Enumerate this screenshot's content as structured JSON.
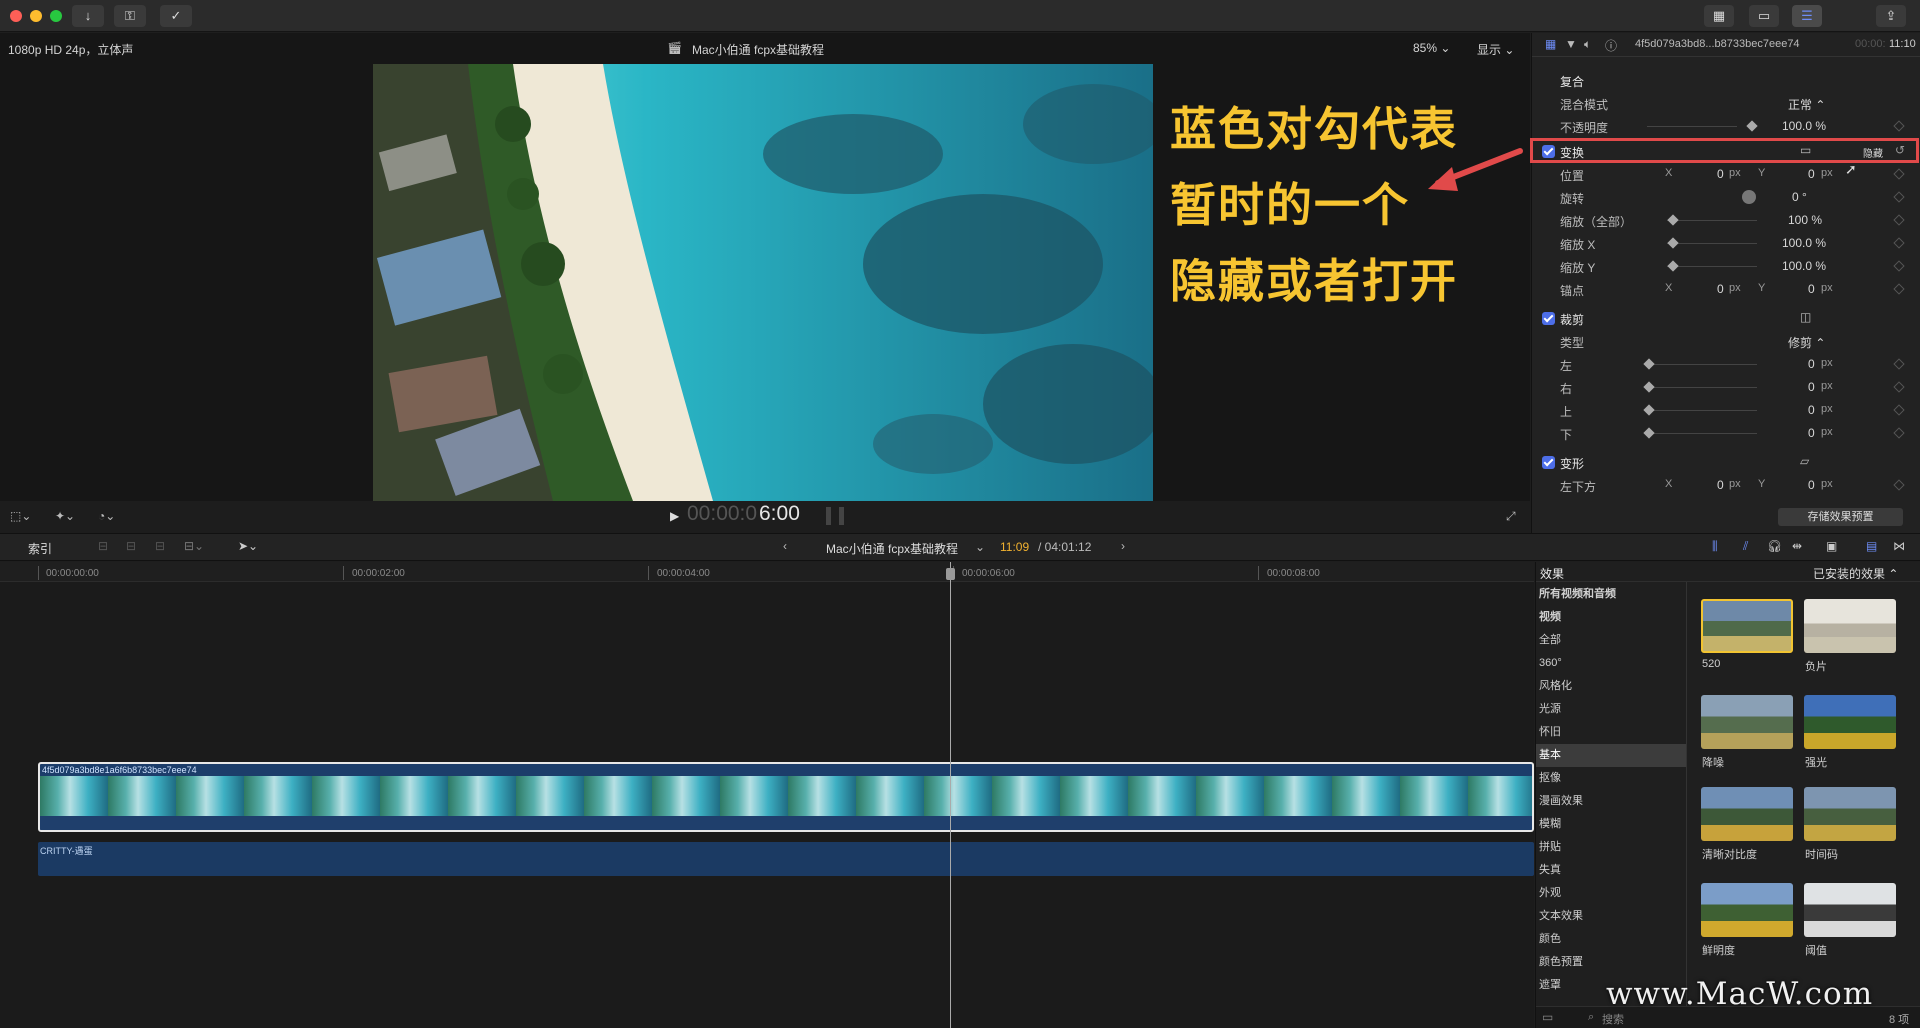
{
  "titlebar": {
    "icons": [
      "import-icon",
      "key-icon",
      "check-circle-icon",
      "grid-view-icon",
      "filmstrip-icon",
      "adjustments-icon",
      "share-icon"
    ]
  },
  "viewer": {
    "format": "1080p HD 24p，立体声",
    "project_title": "Mac小伯通 fcpx基础教程",
    "zoom": "85%",
    "display_menu": "显示",
    "caption_lines": [
      "蓝色对勾代表",
      "暂时的一个",
      "隐藏或者打开"
    ],
    "timecode_dim": "00:00:0",
    "timecode_bright": "6:00"
  },
  "inspector": {
    "clip_name": "4f5d079a3bd8...b8733bec7eee74",
    "duration_dim": "00:00:",
    "duration": "11:10",
    "compound": "复合",
    "blend_mode_label": "混合模式",
    "blend_mode_value": "正常 ⌃",
    "opacity_label": "不透明度",
    "opacity_value": "100.0 %",
    "transform": "变换",
    "hide": "隐藏",
    "position_label": "位置",
    "x_axis": "X",
    "y_axis": "Y",
    "zero_px": "0",
    "px": "px",
    "rotation_label": "旋转",
    "rotation_value": "0 °",
    "scale_all_label": "缩放（全部）",
    "scale_all_value": "100 %",
    "scale_x_label": "缩放 X",
    "scale_x_value": "100.0 %",
    "scale_y_label": "缩放 Y",
    "scale_y_value": "100.0 %",
    "anchor_label": "锚点",
    "crop": "裁剪",
    "type_label": "类型",
    "type_value": "修剪 ⌃",
    "left_label": "左",
    "right_label": "右",
    "top_label": "上",
    "bottom_label": "下",
    "distort": "变形",
    "bottom_left_label": "左下方",
    "save_preset": "存储效果预置"
  },
  "timeline_header": {
    "index": "索引",
    "project": "Mac小伯通 fcpx基础教程",
    "position": "11:09",
    "total": "/ 04:01:12"
  },
  "ruler": [
    "00:00:00:00",
    "00:00:02:00",
    "00:00:04:00",
    "00:00:06:00",
    "00:00:08:00"
  ],
  "timeline": {
    "clip_name": "4f5d079a3bd8e1a6f6b8733bec7eee74",
    "audio_name": "CRITTY-遇蛋"
  },
  "effects": {
    "title": "效果",
    "installed": "已安装的效果 ⌃",
    "categories": [
      "所有视频和音频",
      "视频",
      "全部",
      "360°",
      "风格化",
      "光源",
      "怀旧",
      "基本",
      "抠像",
      "漫画效果",
      "模糊",
      "拼贴",
      "失真",
      "外观",
      "文本效果",
      "颜色",
      "颜色预置",
      "遮罩"
    ],
    "selected_category": "基本",
    "thumbs": [
      "520",
      "负片",
      "降噪",
      "强光",
      "清晰对比度",
      "时间码",
      "鲜明度",
      "阈值"
    ],
    "search_placeholder": "搜索",
    "count": "8 项"
  },
  "watermark": "www.MacW.com",
  "colors": {
    "accent": "#4d6ee8",
    "highlight_box": "#e14a4a",
    "caption": "#f7c531"
  }
}
